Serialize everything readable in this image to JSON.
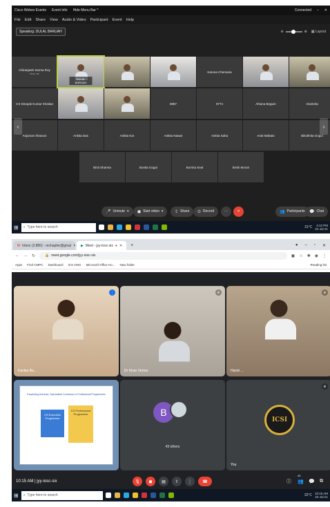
{
  "webex": {
    "title_bar": {
      "app": "Cisco Webex Events",
      "event_info": "Event Info",
      "hide_menu": "Hide Menu Bar ^",
      "status": "Connected"
    },
    "menu": [
      "File",
      "Edit",
      "Share",
      "View",
      "Audio & Video",
      "Participant",
      "Event",
      "Help"
    ],
    "speaking": "Speaking: DULAL BARUAH",
    "layout": "Layout",
    "tiles_row1": [
      {
        "name": "Chiranjeeb Sarma Roy",
        "role": "Host, me",
        "video": false
      },
      {
        "name": "DULAL BARUAH",
        "video": true,
        "active": true
      },
      {
        "name": "",
        "video": true
      },
      {
        "name": "",
        "video": true
      },
      {
        "name": "Karuna Chemaria",
        "video": false
      },
      {
        "name": "",
        "video": true
      },
      {
        "name": "",
        "video": true
      }
    ],
    "tiles_row2": [
      {
        "name": "CS Deepak Kumar Khaitan",
        "video": false
      },
      {
        "name": "",
        "video": true
      },
      {
        "name": "",
        "video": true
      },
      {
        "name": "8887",
        "video": false
      },
      {
        "name": "9774",
        "video": false
      },
      {
        "name": "Afsana Begum",
        "video": false
      },
      {
        "name": "Alankrita",
        "video": false
      }
    ],
    "tiles_row3": [
      {
        "name": "Anjuman khatoon"
      },
      {
        "name": "Ankita Das"
      },
      {
        "name": "Ankita Kar"
      },
      {
        "name": "Ankita Nawar"
      },
      {
        "name": "Ankita Saha"
      },
      {
        "name": "Arati Mahato"
      },
      {
        "name": "Bikokhita Gogoi"
      }
    ],
    "tiles_row4": [
      {
        "name": "Binit Sharma"
      },
      {
        "name": "Bonita Gogoi"
      },
      {
        "name": "Bornita Seal"
      },
      {
        "name": "Brebi Moran"
      }
    ],
    "controls": {
      "unmute": "Unmute",
      "start_video": "Start video",
      "share": "Share",
      "record": "Record",
      "participants": "Participants",
      "chat": "Chat"
    },
    "taskbar": {
      "search": "Type here to search",
      "temp": "31°C",
      "time": "4:12 PM",
      "date": "22-Jul-21"
    }
  },
  "meet": {
    "tabs": [
      {
        "label": "Inbox (2,880) - rechapter@gmai"
      },
      {
        "label": "Meet - jyy-iosc-six",
        "active": true
      }
    ],
    "url": "meet.google.com/jyy-iosc-six",
    "bookmarks": [
      "Apps",
      "Find CMPC",
      "Dashboard",
      "ICS ONG",
      "Microsoft Office Ho...",
      "New folder"
    ],
    "reading_list": "Reading list",
    "tiles": [
      {
        "name": "Kanika Ba..."
      },
      {
        "name": "Dr Kiran Verma"
      },
      {
        "name": "Harsh ..."
      },
      {
        "name": ""
      },
      {
        "name": "43 others",
        "initial": "B"
      },
      {
        "name": "You",
        "logo": "ICSI"
      }
    ],
    "slide": {
      "title": "Expanding Avenues: Specialised Curriculum & Professional Programmes",
      "box1": "CS Executive Programme",
      "box2": "CS Professional Programme"
    },
    "meeting_time": "10:15 AM",
    "meeting_code": "jyy-iosc-six",
    "participant_count": "44",
    "taskbar": {
      "search": "Type here to search",
      "temp": "32°C",
      "time": "10:15 AM",
      "date": "22-Jul-21"
    }
  }
}
